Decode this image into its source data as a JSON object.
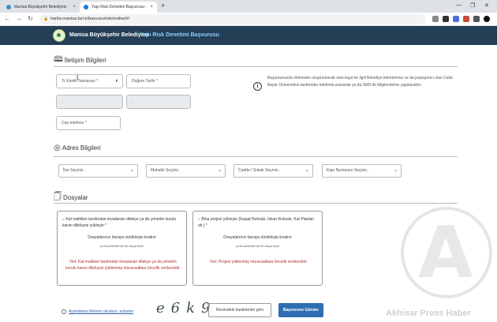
{
  "browser": {
    "tabs": [
      {
        "label": "Manisa Büyükşehir Belediyesi",
        "active": false
      },
      {
        "label": "Yapı Risk Denetimi Başvurusu - M",
        "active": true
      }
    ],
    "url": "harita.manisa.bel.tr/basvuru/risk/online/#/",
    "new_tab": "+",
    "close": "×"
  },
  "header": {
    "brand": "Manisa Büyükşehir Belediyesi",
    "title": "Yapı Risk Denetimi Başvurusu"
  },
  "contact": {
    "section_title": "İletişim Bilgileri",
    "tc_placeholder": "Tc Kimlik Numarası *",
    "birthdate_placeholder": "Doğum Tarihi *",
    "disabled_a": "-",
    "disabled_b": "-",
    "phone_placeholder": "Cep telefonu *",
    "info": "Başvurunuzda iletmeden oluşturulacak olan kayıt ile ilgili Belediye birimlerimiz ve da paylaşımcı olan Celal Bayar Üniversitesi tarafından telefonla aranarak ya da SMS ile bilgilendirme yapılacaktır."
  },
  "address": {
    "section_title": "Adres Bilgileri",
    "selects": [
      "İlçe Seçiniz..",
      "Mahalle Seçiniz..",
      "Cadde / Sokak Seçiniz..",
      "Kapı Numarası Seçiniz.."
    ]
  },
  "files": {
    "section_title": "Dosyalar",
    "upload1": {
      "label": "Kat malikleri tarafından imzalanan dilekçe ya da yönetim kurulu kararı dilekçesi yükleyin *",
      "drop": "Dosyalarınızı buraya sürükleyip bırakın",
      "small": "ya da yüklemek için bir dosya seçin",
      "note": "Not: Kat malikleri tarafından imzalanan dilekçe ya da yönetim kurulu kararı dilekçesi yüklenmiş müracaatlara öncelik verilecektir."
    },
    "upload2": {
      "label": "Bina projesi yükleyin (İnşaat Ruhsatı, İskan Ruhsatı, Kat Planları vb.) *",
      "drop": "Dosyalarınızı buraya sürükleyip bırakın",
      "small": "ya da yüklemek için bir dosya seçin",
      "note": "Not: Projesi yüklenmiş müracaatlara öncelik verilecektir."
    }
  },
  "footer": {
    "kvkk_link": "Aydınlatma Metnini okudum, anladım",
    "captcha": "e6k9",
    "captcha_placeholder": "Resimdeki karakterleri girin",
    "submit": "Başvurunu Gönder"
  },
  "watermark": {
    "text": "Akhisar Press Haber",
    "letter": "A"
  },
  "colors": {
    "header_bg": "#243e55",
    "accent": "#2f6db0",
    "note_red": "#b03030"
  }
}
